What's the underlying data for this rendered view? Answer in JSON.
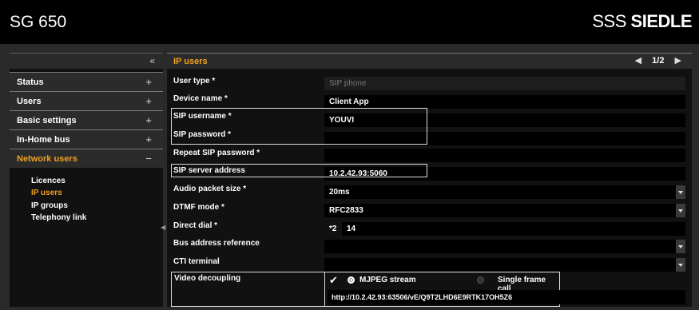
{
  "app": {
    "title": "SG 650",
    "brand_light": "SSS",
    "brand_bold": "SIEDLE"
  },
  "sidebar": {
    "collapse_icon": "«",
    "items": [
      {
        "label": "Status",
        "sign": "+"
      },
      {
        "label": "Users",
        "sign": "+"
      },
      {
        "label": "Basic settings",
        "sign": "+"
      },
      {
        "label": "In-Home bus",
        "sign": "+"
      },
      {
        "label": "Network users",
        "sign": "−"
      }
    ],
    "subitems": [
      "Licences",
      "IP users",
      "IP groups",
      "Telephony link"
    ]
  },
  "panel": {
    "title": "IP users",
    "pager": {
      "prev": "◀",
      "page": "1/2",
      "next": "▶"
    }
  },
  "form": {
    "user_type": {
      "label": "User type *",
      "value": "SIP phone"
    },
    "device_name": {
      "label": "Device name *",
      "value": "Client App"
    },
    "sip_username": {
      "label": "SIP username *",
      "value": "YOUVI"
    },
    "sip_password": {
      "label": "SIP password *",
      "value": ""
    },
    "repeat_password": {
      "label": "Repeat SIP password *",
      "value": ""
    },
    "sip_server": {
      "label": "SIP server address",
      "value": "10.2.42.93:5060"
    },
    "audio_packet": {
      "label": "Audio packet size *",
      "value": "20ms"
    },
    "dtmf_mode": {
      "label": "DTMF mode *",
      "value": "RFC2833"
    },
    "direct_dial": {
      "label": "Direct dial *",
      "prefix": "*2",
      "value": "14"
    },
    "bus_address": {
      "label": "Bus address reference",
      "value": ""
    },
    "cti_terminal": {
      "label": "CTI terminal",
      "value": ""
    },
    "video": {
      "label": "Video decoupling",
      "checkbox_glyph": "✔",
      "option_mjpeg": "MJPEG stream",
      "option_single": "Single frame call",
      "selected": "MJPEG stream",
      "url": "http://10.2.42.93:63506/vE/Q9T2LHD6E9RTK17OH5Z6"
    }
  }
}
